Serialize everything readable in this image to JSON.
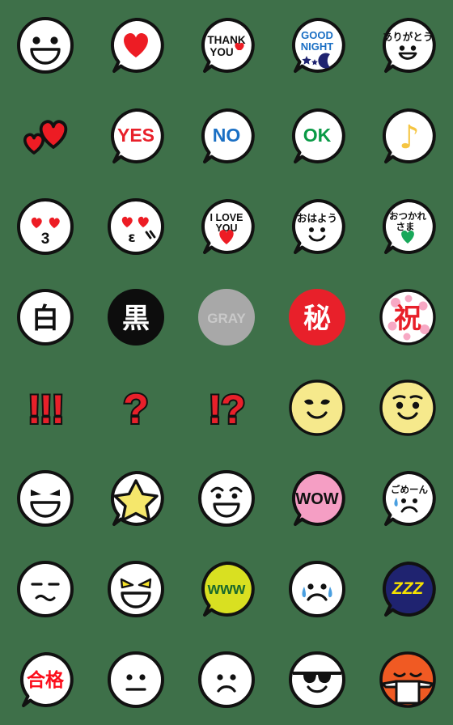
{
  "page": {
    "title": "Emoji sticker set preview",
    "background_color": "#3e7049",
    "columns": 5,
    "rows": 8,
    "cell_size_px": 112,
    "sticker_count": 40
  },
  "palette": {
    "outline": "#111111",
    "white": "#ffffff",
    "red": "#e8202a",
    "heart_red": "#ed1c24",
    "blue": "#1a6fc4",
    "navy": "#1f2370",
    "green": "#0a9a46",
    "dark_green": "#1d6b2b",
    "yellow": "#f5e76b",
    "yellow_face": "#f6e98c",
    "gold": "#f5c542",
    "orange": "#f05a23",
    "pink": "#f59ec4",
    "light_pink": "#f4a7c0",
    "gray": "#a8a8a8",
    "light_gray": "#c9c9c9",
    "yellow_green": "#d9e021",
    "tear_blue": "#4a9fe0",
    "sakura_pink": "#f7a8c4"
  },
  "stickers": [
    {
      "id": 1,
      "row": 1,
      "col": 1,
      "name": "smiley-open-grin",
      "shape": "circle",
      "label": "",
      "label_color": "#111111",
      "fill": "#ffffff",
      "description": "white circle face with two dot eyes and wide open grin"
    },
    {
      "id": 2,
      "row": 1,
      "col": 2,
      "name": "heart-bubble",
      "shape": "bubble",
      "label": "",
      "label_color": "#ed1c24",
      "fill": "#ffffff",
      "description": "speech bubble containing a large red heart"
    },
    {
      "id": 3,
      "row": 1,
      "col": 3,
      "name": "thank-you-bubble",
      "shape": "bubble",
      "label": "THANK YOU",
      "label_color": "#111111",
      "fill": "#ffffff",
      "description": "speech bubble reading THANK YOU with small red heart"
    },
    {
      "id": 4,
      "row": 1,
      "col": 4,
      "name": "good-night-bubble",
      "shape": "bubble",
      "label": "GOOD NIGHT",
      "label_color": "#1a6fc4",
      "fill": "#ffffff",
      "description": "speech bubble reading GOOD NIGHT with navy stars and crescent moon"
    },
    {
      "id": 5,
      "row": 1,
      "col": 5,
      "name": "arigatou-bubble",
      "shape": "bubble",
      "label": "ありがとう",
      "label_color": "#111111",
      "fill": "#ffffff",
      "description": "speech bubble reading arigatou above a smiling face"
    },
    {
      "id": 6,
      "row": 2,
      "col": 1,
      "name": "two-hearts",
      "shape": "none",
      "label": "",
      "label_color": "#ed1c24",
      "fill": "none",
      "description": "two red hearts, one large and one small"
    },
    {
      "id": 7,
      "row": 2,
      "col": 2,
      "name": "yes-bubble",
      "shape": "bubble",
      "label": "YES",
      "label_color": "#e8202a",
      "fill": "#ffffff",
      "description": "speech bubble reading YES in red"
    },
    {
      "id": 8,
      "row": 2,
      "col": 3,
      "name": "no-bubble",
      "shape": "bubble",
      "label": "NO",
      "label_color": "#1a6fc4",
      "fill": "#ffffff",
      "description": "speech bubble reading NO in blue"
    },
    {
      "id": 9,
      "row": 2,
      "col": 4,
      "name": "ok-bubble",
      "shape": "bubble",
      "label": "OK",
      "label_color": "#0a9a46",
      "fill": "#ffffff",
      "description": "speech bubble reading OK in green"
    },
    {
      "id": 10,
      "row": 2,
      "col": 5,
      "name": "music-note-bubble",
      "shape": "bubble",
      "label": "♪",
      "label_color": "#f5c542",
      "fill": "#ffffff",
      "description": "speech bubble containing an orange eighth note"
    },
    {
      "id": 11,
      "row": 3,
      "col": 1,
      "name": "heart-eyes-kiss-face",
      "shape": "circle",
      "label": "3",
      "label_color": "#111111",
      "fill": "#ffffff",
      "description": "face with red heart eyes and number three shaped mouth"
    },
    {
      "id": 12,
      "row": 3,
      "col": 2,
      "name": "heart-eyes-blush-face",
      "shape": "circle",
      "label": "ε",
      "label_color": "#111111",
      "fill": "#ffffff",
      "description": "face with red heart eyes, epsilon mouth and blush marks"
    },
    {
      "id": 13,
      "row": 3,
      "col": 3,
      "name": "i-love-you-bubble",
      "shape": "bubble",
      "label": "I LOVE YOU",
      "label_color": "#111111",
      "fill": "#ffffff",
      "description": "speech bubble reading I LOVE YOU with red heart"
    },
    {
      "id": 14,
      "row": 3,
      "col": 4,
      "name": "ohayou-bubble",
      "shape": "bubble",
      "label": "おはよう",
      "label_color": "#111111",
      "fill": "#ffffff",
      "description": "speech bubble reading ohayou above smiling face"
    },
    {
      "id": 15,
      "row": 3,
      "col": 5,
      "name": "otsukaresama-bubble",
      "shape": "bubble",
      "label": "おつかれさま",
      "label_color": "#111111",
      "fill": "#ffffff",
      "description": "speech bubble reading otsukaresama with green heart"
    },
    {
      "id": 16,
      "row": 4,
      "col": 1,
      "name": "shiro-white-badge",
      "shape": "circle",
      "label": "白",
      "label_color": "#111111",
      "fill": "#ffffff",
      "description": "white circle with kanji for white"
    },
    {
      "id": 17,
      "row": 4,
      "col": 2,
      "name": "kuro-black-badge",
      "shape": "circle",
      "label": "黒",
      "label_color": "#ffffff",
      "fill": "#0d0d0d",
      "description": "black circle with white kanji for black"
    },
    {
      "id": 18,
      "row": 4,
      "col": 3,
      "name": "gray-badge",
      "shape": "circle",
      "label": "GRAY",
      "label_color": "#c9c9c9",
      "fill": "#a8a8a8",
      "description": "gray circle with lighter gray GRAY text"
    },
    {
      "id": 19,
      "row": 4,
      "col": 4,
      "name": "himitsu-secret-badge",
      "shape": "circle",
      "label": "秘",
      "label_color": "#ffffff",
      "fill": "#e8202a",
      "description": "red circle with white kanji for secret"
    },
    {
      "id": 20,
      "row": 4,
      "col": 5,
      "name": "iwai-celebrate-badge",
      "shape": "circle",
      "label": "祝",
      "label_color": "#e8202a",
      "fill": "#ffffff",
      "description": "white circle with red kanji for celebration and pink cherry blossoms"
    },
    {
      "id": 21,
      "row": 5,
      "col": 1,
      "name": "triple-exclamation",
      "shape": "none",
      "label": "!!!",
      "label_color": "#e8202a",
      "fill": "none",
      "description": "three red exclamation marks with black outline"
    },
    {
      "id": 22,
      "row": 5,
      "col": 2,
      "name": "question-mark",
      "shape": "none",
      "label": "?",
      "label_color": "#e8202a",
      "fill": "none",
      "description": "red question mark with black outline"
    },
    {
      "id": 23,
      "row": 5,
      "col": 3,
      "name": "interrobang",
      "shape": "none",
      "label": "!?",
      "label_color": "#e8202a",
      "fill": "none",
      "description": "red exclamation and question mark with black outline"
    },
    {
      "id": 24,
      "row": 5,
      "col": 4,
      "name": "yellow-smirk-face",
      "shape": "circle",
      "label": "",
      "label_color": "#111111",
      "fill": "#f6e98c",
      "description": "yellow face with half lidded eyes and smile"
    },
    {
      "id": 25,
      "row": 5,
      "col": 5,
      "name": "yellow-eyebrow-face",
      "shape": "circle",
      "label": "",
      "label_color": "#111111",
      "fill": "#f6e98c",
      "description": "yellow face with raised eyebrows and smile"
    },
    {
      "id": 26,
      "row": 6,
      "col": 1,
      "name": "mischievous-grin-face",
      "shape": "circle",
      "label": "",
      "label_color": "#111111",
      "fill": "#ffffff",
      "description": "white face with slanted eyebrows and wide grin"
    },
    {
      "id": 27,
      "row": 6,
      "col": 2,
      "name": "star-bubble",
      "shape": "bubble",
      "label": "★",
      "label_color": "#f5e76b",
      "fill": "#ffffff",
      "description": "speech bubble containing a yellow star"
    },
    {
      "id": 28,
      "row": 6,
      "col": 3,
      "name": "relieved-grin-face",
      "shape": "circle",
      "label": "",
      "label_color": "#111111",
      "fill": "#ffffff",
      "description": "white face with worried eyebrows and open smile"
    },
    {
      "id": 29,
      "row": 6,
      "col": 4,
      "name": "wow-bubble",
      "shape": "bubble",
      "label": "WOW",
      "label_color": "#111111",
      "fill": "#f59ec4",
      "description": "pink speech bubble reading WOW"
    },
    {
      "id": 30,
      "row": 6,
      "col": 5,
      "name": "gomen-bubble",
      "shape": "bubble",
      "label": "ごめーん",
      "label_color": "#111111",
      "fill": "#ffffff",
      "description": "speech bubble reading gomen with sad face and sweat drop"
    },
    {
      "id": 31,
      "row": 7,
      "col": 1,
      "name": "unamused-face",
      "shape": "circle",
      "label": "",
      "label_color": "#111111",
      "fill": "#ffffff",
      "description": "white face with flat closed eyes and wavy mouth"
    },
    {
      "id": 32,
      "row": 7,
      "col": 2,
      "name": "devil-grin-face",
      "shape": "circle",
      "label": "",
      "label_color": "#111111",
      "fill": "#ffffff",
      "description": "white face with yellow angled eyes and wide grin"
    },
    {
      "id": 33,
      "row": 7,
      "col": 3,
      "name": "www-bubble",
      "shape": "bubble",
      "label": "www",
      "label_color": "#1d6b2b",
      "fill": "#d9e021",
      "description": "yellow green speech bubble reading www"
    },
    {
      "id": 34,
      "row": 7,
      "col": 4,
      "name": "crying-face",
      "shape": "circle",
      "label": "",
      "label_color": "#111111",
      "fill": "#ffffff",
      "description": "white sad face with blue tears"
    },
    {
      "id": 35,
      "row": 7,
      "col": 5,
      "name": "zzz-bubble",
      "shape": "bubble",
      "label": "ZZZ",
      "label_color": "#f7e200",
      "fill": "#1f2370",
      "description": "navy speech bubble reading ZZZ in yellow"
    },
    {
      "id": 36,
      "row": 8,
      "col": 1,
      "name": "goukaku-pass-bubble",
      "shape": "bubble",
      "label": "合格",
      "label_color": "#e8202a",
      "fill": "#ffffff",
      "description": "speech bubble reading goukaku pass in red"
    },
    {
      "id": 37,
      "row": 8,
      "col": 2,
      "name": "neutral-face",
      "shape": "circle",
      "label": "",
      "label_color": "#111111",
      "fill": "#ffffff",
      "description": "white face with two dot eyes and straight mouth"
    },
    {
      "id": 38,
      "row": 8,
      "col": 3,
      "name": "frowning-face",
      "shape": "circle",
      "label": "",
      "label_color": "#111111",
      "fill": "#ffffff",
      "description": "white face with two dot eyes and frowning mouth"
    },
    {
      "id": 39,
      "row": 8,
      "col": 4,
      "name": "sunglasses-face",
      "shape": "circle",
      "label": "",
      "label_color": "#111111",
      "fill": "#ffffff",
      "description": "white face wearing black sunglasses with smile"
    },
    {
      "id": 40,
      "row": 8,
      "col": 5,
      "name": "sick-mask-face",
      "shape": "circle",
      "label": "",
      "label_color": "#111111",
      "fill": "#f05a23",
      "description": "orange face wearing a white surgical mask"
    }
  ]
}
